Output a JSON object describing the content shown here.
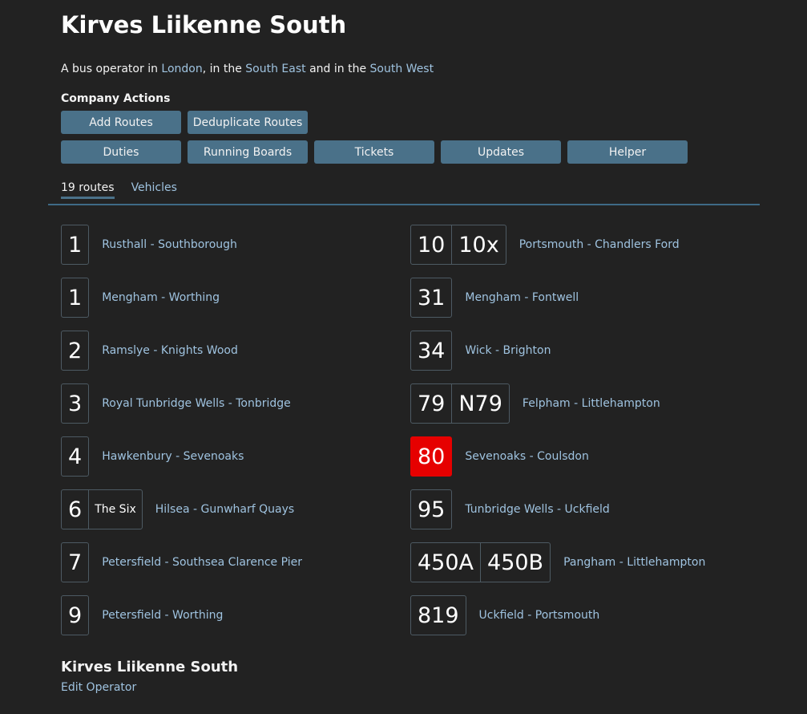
{
  "operator": {
    "name": "Kirves Liikenne South",
    "intro_prefix": "A bus operator in ",
    "region_1": "London",
    "sep_1": ", in the ",
    "region_2": "South East",
    "sep_2": " and in the ",
    "region_3": "South West"
  },
  "actions": {
    "title": "Company Actions",
    "row1": [
      "Add Routes",
      "Deduplicate Routes"
    ],
    "row2": [
      "Duties",
      "Running Boards",
      "Tickets",
      "Updates",
      "Helper"
    ]
  },
  "tabs": [
    {
      "label": "19 routes",
      "active": true
    },
    {
      "label": "Vehicles",
      "active": false
    }
  ],
  "routes_left": [
    {
      "numbers": [
        "1"
      ],
      "name": "Rusthall - Southborough"
    },
    {
      "numbers": [
        "1"
      ],
      "name": "Mengham - Worthing"
    },
    {
      "numbers": [
        "2"
      ],
      "name": "Ramslye - Knights Wood"
    },
    {
      "numbers": [
        "3"
      ],
      "name": "Royal Tunbridge Wells - Tonbridge"
    },
    {
      "numbers": [
        "4"
      ],
      "name": "Hawkenbury - Sevenoaks"
    },
    {
      "numbers": [
        "6",
        "The Six"
      ],
      "name": "Hilsea - Gunwharf Quays"
    },
    {
      "numbers": [
        "7"
      ],
      "name": "Petersfield - Southsea Clarence Pier"
    },
    {
      "numbers": [
        "9"
      ],
      "name": "Petersfield - Worthing"
    }
  ],
  "routes_right": [
    {
      "numbers": [
        "10",
        "10x"
      ],
      "name": "Portsmouth - Chandlers Ford"
    },
    {
      "numbers": [
        "31"
      ],
      "name": "Mengham - Fontwell"
    },
    {
      "numbers": [
        "34"
      ],
      "name": "Wick - Brighton"
    },
    {
      "numbers": [
        "79",
        "N79"
      ],
      "name": "Felpham - Littlehampton"
    },
    {
      "numbers": [
        "80"
      ],
      "name": "Sevenoaks - Coulsdon",
      "color": "#e60000"
    },
    {
      "numbers": [
        "95"
      ],
      "name": "Tunbridge Wells - Uckfield"
    },
    {
      "numbers": [
        "450A",
        "450B"
      ],
      "name": "Pangham - Littlehampton"
    },
    {
      "numbers": [
        "819"
      ],
      "name": "Uckfield - Portsmouth"
    }
  ],
  "footer": {
    "title": "Kirves Liikenne South",
    "edit_label": "Edit Operator"
  },
  "colors": {
    "background": "#222222",
    "button": "#4a7189",
    "link": "#9fc3e0",
    "highlight_route": "#e60000"
  }
}
